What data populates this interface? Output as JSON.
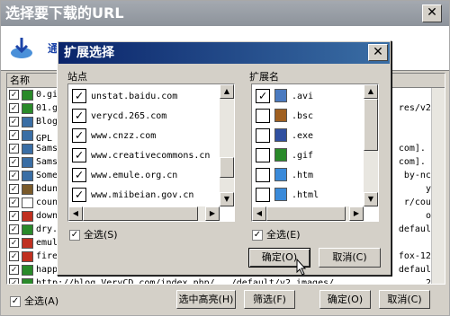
{
  "outer": {
    "title": "选择要下载的URL",
    "banner_text": "通",
    "list_header": "名称",
    "rows": [
      {
        "icon": "gif",
        "name": "0.gif",
        "tail": ""
      },
      {
        "icon": "gif",
        "name": "01.gi",
        "tail": "res/v2_i"
      },
      {
        "icon": "link",
        "name": "Blog",
        "tail": ""
      },
      {
        "icon": "link",
        "name": "GPL 协",
        "tail": ""
      },
      {
        "icon": "link",
        "name": "Samsa",
        "tail": "com]. [S"
      },
      {
        "icon": "link",
        "name": "Samsa",
        "tail": "com]. [S"
      },
      {
        "icon": "link",
        "name": "Some",
        "tail": "by-nc-s"
      },
      {
        "icon": "img",
        "name": "bdun.",
        "tail": "ycd"
      },
      {
        "icon": "blank",
        "name": "count",
        "tail": "r/count"
      },
      {
        "icon": "png",
        "name": "downl",
        "tail": "ong"
      },
      {
        "icon": "gif",
        "name": "dry.g",
        "tail": "default/"
      },
      {
        "icon": "png",
        "name": "emule",
        "tail": ""
      },
      {
        "icon": "png",
        "name": "firef",
        "tail": "fox-125x"
      },
      {
        "icon": "gif",
        "name": "happy",
        "tail": "default/"
      },
      {
        "icon": "gif",
        "name": "http://blog.VeryCD.com/index.php/.../default/v2_images/",
        "tail": "252"
      }
    ],
    "select_all": "全选(A)",
    "buttons": {
      "highlight": "选中高亮(H)",
      "filter": "筛选(F)",
      "ok": "确定(O)",
      "cancel": "取消(C)"
    }
  },
  "dialog": {
    "title": "扩展选择",
    "sites_label": "站点",
    "ext_label": "扩展名",
    "sites": [
      {
        "checked": true,
        "label": "unstat.baidu.com"
      },
      {
        "checked": true,
        "label": "verycd.265.com"
      },
      {
        "checked": true,
        "label": "www.cnzz.com"
      },
      {
        "checked": true,
        "label": "www.creativecommons.cn"
      },
      {
        "checked": true,
        "label": "www.emule.org.cn"
      },
      {
        "checked": true,
        "label": "www.miibeian.gov.cn"
      }
    ],
    "extensions": [
      {
        "checked": true,
        "icon": "avi",
        "label": ".avi"
      },
      {
        "checked": false,
        "icon": "bsc",
        "label": ".bsc"
      },
      {
        "checked": false,
        "icon": "exe",
        "label": ".exe"
      },
      {
        "checked": false,
        "icon": "gif",
        "label": ".gif"
      },
      {
        "checked": false,
        "icon": "htm",
        "label": ".htm"
      },
      {
        "checked": false,
        "icon": "html",
        "label": ".html"
      }
    ],
    "sites_select_all": "全选(S)",
    "ext_select_all": "全选(E)",
    "ok": "确定(O)",
    "cancel": "取消(C)"
  },
  "colors": {
    "title_active": "#0a246a",
    "title_inactive": "#8d939b",
    "face": "#d4d0c8"
  }
}
